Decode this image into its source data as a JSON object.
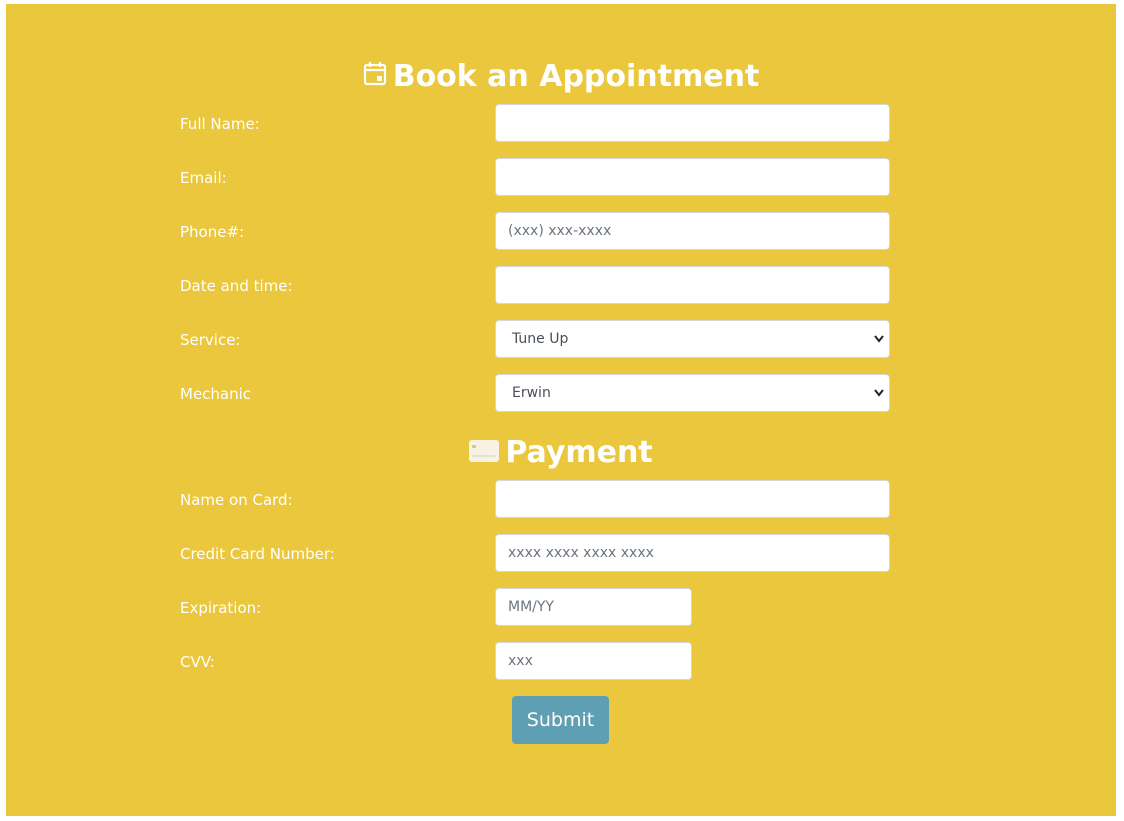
{
  "headings": {
    "appointment": "Book an Appointment",
    "payment": "Payment"
  },
  "icons": {
    "appointment": "calendar-icon",
    "payment": "credit-card-icon"
  },
  "colors": {
    "background": "#eac73c",
    "text": "#ffffff",
    "submit": "#5f9fb3"
  },
  "form": {
    "full_name": {
      "label": "Full Name:",
      "value": "",
      "placeholder": ""
    },
    "email": {
      "label": "Email:",
      "value": "",
      "placeholder": ""
    },
    "phone": {
      "label": "Phone#:",
      "value": "",
      "placeholder": "(xxx) xxx-xxxx"
    },
    "datetime": {
      "label": "Date and time:",
      "value": "",
      "placeholder": ""
    },
    "service": {
      "label": "Service:",
      "selected": "Tune Up"
    },
    "mechanic": {
      "label": "Mechanic",
      "selected": "Erwin"
    }
  },
  "payment": {
    "name_on_card": {
      "label": "Name on Card:",
      "value": "",
      "placeholder": ""
    },
    "card_number": {
      "label": "Credit Card Number:",
      "value": "",
      "placeholder": "xxxx xxxx xxxx xxxx"
    },
    "expiration": {
      "label": "Expiration:",
      "value": "",
      "placeholder": "MM/YY"
    },
    "cvv": {
      "label": "CVV:",
      "value": "",
      "placeholder": "xxx"
    }
  },
  "submit_label": "Submit"
}
